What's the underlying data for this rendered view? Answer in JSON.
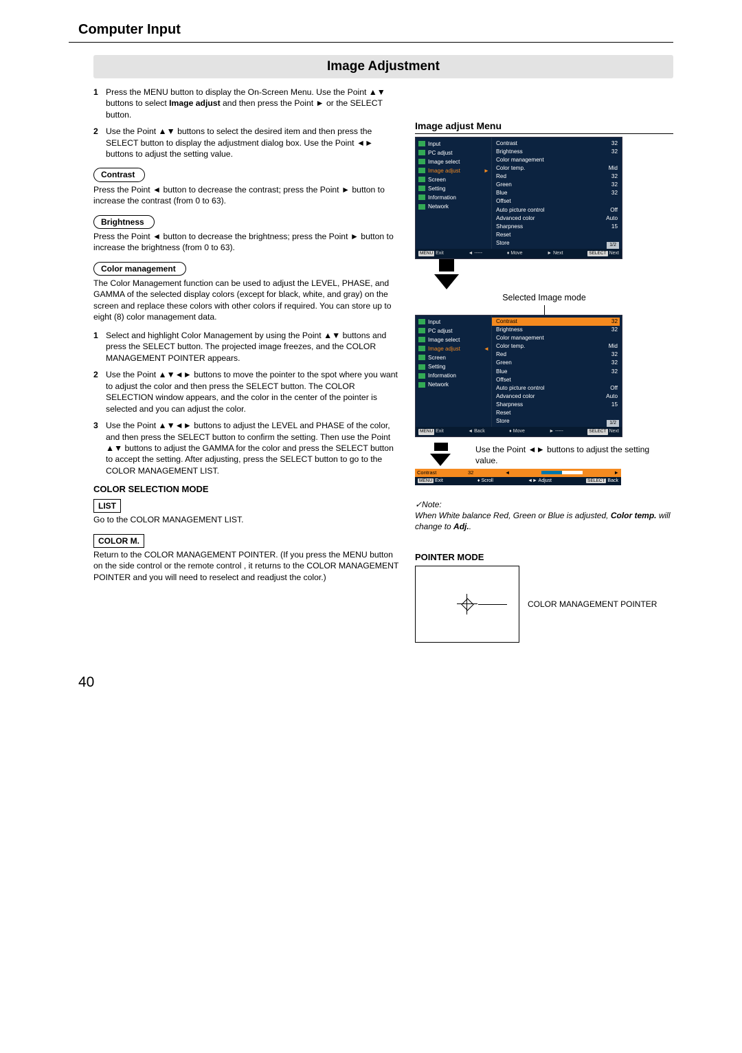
{
  "header": {
    "section": "Computer Input",
    "title": "Image Adjustment"
  },
  "steps_intro": [
    "Press the MENU button to display the On-Screen Menu. Use the Point ▲▼ buttons to select <b>Image adjust</b> and then press the Point ► or the SELECT button.",
    "Use the Point ▲▼ buttons to select the desired item and then press the SELECT button to display the adjustment dialog box. Use the Point ◄► buttons to adjust the setting value."
  ],
  "contrast": {
    "label": "Contrast",
    "text": "Press the Point ◄ button to decrease the contrast; press the Point ► button to increase the contrast (from 0 to 63)."
  },
  "brightness": {
    "label": "Brightness",
    "text": "Press the Point ◄ button to decrease the brightness; press the Point ► button to increase the brightness (from 0 to 63)."
  },
  "colormgmt": {
    "label": "Color management",
    "text": "The Color Management function can be used to adjust the LEVEL, PHASE, and GAMMA of the selected display colors (except for black, white, and gray) on the screen and replace these colors with other colors if required. You can store up to eight (8) color management data."
  },
  "cm_steps": [
    "Select and highlight Color Management by using the Point ▲▼ buttons and press the SELECT button. The projected image freezes, and the COLOR MANAGEMENT POINTER appears.",
    "Use the Point ▲▼◄► buttons to move the pointer to the spot where you want to adjust the color and then press the SELECT button. The COLOR SELECTION window appears, and the color in the center of the pointer is selected and you can adjust the color.",
    "Use the Point ▲▼◄► buttons to adjust the LEVEL and PHASE of the color, and then press the SELECT button to confirm the setting. Then use the Point ▲▼ buttons to adjust the GAMMA for the color and press the SELECT button to accept the setting. After adjusting, press the SELECT button to go to the COLOR MANAGEMENT LIST."
  ],
  "csmode": {
    "title": "COLOR SELECTION MODE",
    "list_label": "LIST",
    "list_text": "Go to the COLOR MANAGEMENT LIST.",
    "colorm_label": "COLOR M.",
    "colorm_text": "Return to the COLOR MANAGEMENT POINTER. (If you press the MENU button on the side control or the remote control , it returns to the COLOR MANAGEMENT POINTER and you will need to reselect and readjust the color.)"
  },
  "right": {
    "menu_title": "Image adjust Menu",
    "caption_mid": "Selected Image mode",
    "hint": "Use the Point ◄► buttons to adjust the setting value.",
    "note_title": "✓Note:",
    "note_body": "When White balance Red, Green or Blue is adjusted, <b>Color temp.</b> will change to <b>Adj.</b>.",
    "pointer_title": "POINTER MODE",
    "pointer_label": "COLOR MANAGEMENT POINTER"
  },
  "osd": {
    "side": [
      "Input",
      "PC adjust",
      "Image select",
      "Image adjust",
      "Screen",
      "Setting",
      "Information",
      "Network"
    ],
    "rows": [
      [
        "Contrast",
        "32"
      ],
      [
        "Brightness",
        "32"
      ],
      [
        "Color management",
        ""
      ],
      [
        "Color temp.",
        "Mid"
      ],
      [
        "Red",
        "32"
      ],
      [
        "Green",
        "32"
      ],
      [
        "Blue",
        "32"
      ],
      [
        "Offset",
        ""
      ],
      [
        "Auto picture control",
        "Off"
      ],
      [
        "Advanced color",
        "Auto"
      ],
      [
        "Sharpness",
        "15"
      ],
      [
        "Reset",
        ""
      ],
      [
        "Store",
        ""
      ]
    ],
    "page": "1/2",
    "foot": {
      "exit": "Exit",
      "back": "◄ -----",
      "move": "Move",
      "next": "► Next",
      "sel": "Next"
    },
    "foot2": {
      "exit": "Exit",
      "back": "◄ Back",
      "move": "Move",
      "next": "► -----",
      "sel": "Next"
    },
    "menu": "MENU",
    "select": "SELECT",
    "slider": {
      "name": "Contrast",
      "val": "32",
      "exit": "Exit",
      "scroll": "Scroll",
      "adjust": "Adjust",
      "back": "Back"
    }
  },
  "pagenum": "40",
  "chart_data": {
    "type": "table",
    "title": "Image adjust Menu (OSD)",
    "columns": [
      "Item",
      "Value"
    ],
    "rows": [
      [
        "Contrast",
        "32"
      ],
      [
        "Brightness",
        "32"
      ],
      [
        "Color management",
        ""
      ],
      [
        "Color temp.",
        "Mid"
      ],
      [
        "Red",
        "32"
      ],
      [
        "Green",
        "32"
      ],
      [
        "Blue",
        "32"
      ],
      [
        "Offset",
        ""
      ],
      [
        "Auto picture control",
        "Off"
      ],
      [
        "Advanced color",
        "Auto"
      ],
      [
        "Sharpness",
        "15"
      ],
      [
        "Reset",
        ""
      ],
      [
        "Store",
        ""
      ]
    ]
  }
}
